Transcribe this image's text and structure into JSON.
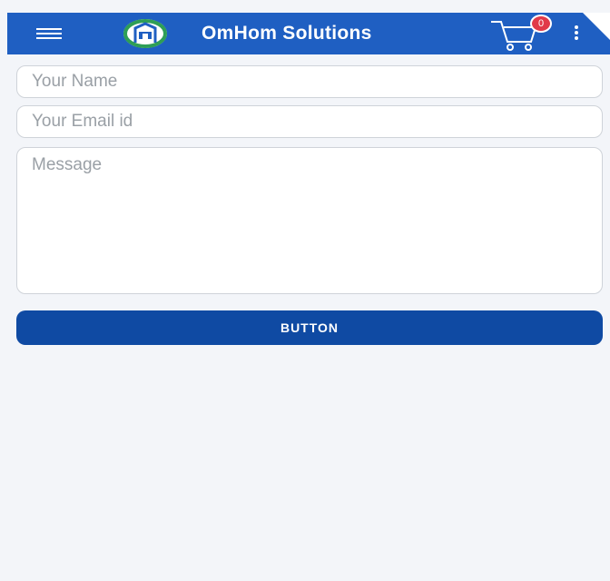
{
  "app_bar": {
    "title": "OmHom Solutions",
    "cart_count": "0",
    "icons": {
      "menu": "hamburger-menu-icon",
      "logo": "omhom-house-logo",
      "cart": "shopping-cart-icon",
      "more": "more-vert-icon"
    },
    "color": "#1f5fc2"
  },
  "form": {
    "name_placeholder": "Your Name",
    "email_placeholder": "Your Email id",
    "message_placeholder": "Message",
    "button_label": "BUTTON",
    "button_color": "#0f4aa3"
  }
}
